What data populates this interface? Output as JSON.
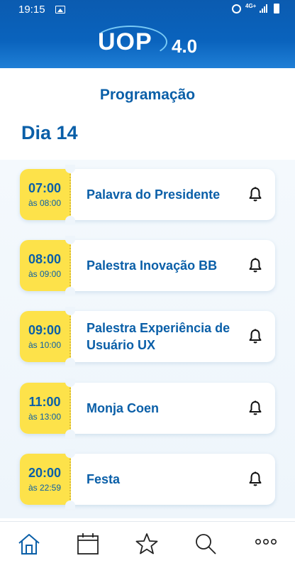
{
  "status_bar": {
    "time": "19:15",
    "network": "4G+"
  },
  "header": {
    "logo_text": "UOP",
    "logo_version": "4.0"
  },
  "page": {
    "title": "Programação",
    "day": "Dia 14"
  },
  "schedule": [
    {
      "start": "07:00",
      "end": "às 08:00",
      "title": "Palavra do Presidente"
    },
    {
      "start": "08:00",
      "end": "às 09:00",
      "title": "Palestra Inovação BB"
    },
    {
      "start": "09:00",
      "end": "às 10:00",
      "title": "Palestra Experiência de Usuário UX"
    },
    {
      "start": "11:00",
      "end": "às 13:00",
      "title": "Monja Coen"
    },
    {
      "start": "20:00",
      "end": "às 22:59",
      "title": "Festa"
    }
  ],
  "bottom_nav": [
    {
      "icon": "home-icon",
      "active": true
    },
    {
      "icon": "calendar-icon",
      "active": false
    },
    {
      "icon": "star-icon",
      "active": false
    },
    {
      "icon": "search-icon",
      "active": false
    },
    {
      "icon": "more-icon",
      "active": false
    }
  ],
  "colors": {
    "primary": "#0a5fa8",
    "ticket": "#fde24a",
    "header": "#0b5bb0"
  }
}
